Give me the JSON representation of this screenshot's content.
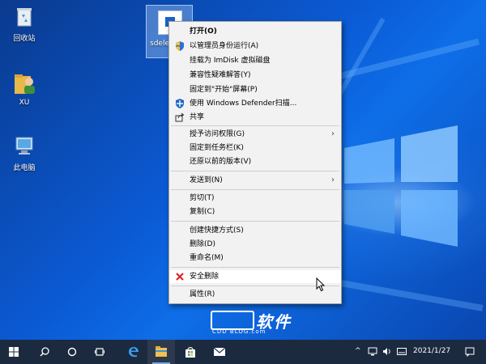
{
  "desktop": {
    "icons": [
      {
        "label": "回收站",
        "icon": "recycle-bin-icon"
      },
      {
        "label": "XU",
        "icon": "user-folder-icon"
      },
      {
        "label": "此电脑",
        "icon": "this-pc-icon"
      }
    ],
    "selected_file": {
      "label": "sdele",
      "icon": "file-icon"
    }
  },
  "context_menu": {
    "items": [
      {
        "label": "打开(O)",
        "bold": true
      },
      {
        "label": "以管理员身份运行(A)",
        "icon": "uac-shield-icon"
      },
      {
        "label": "挂载为 ImDisk 虚拟磁盘"
      },
      {
        "label": "兼容性疑难解答(Y)"
      },
      {
        "label": "固定到\"开始\"屏幕(P)"
      },
      {
        "label": "使用 Windows Defender扫描...",
        "icon": "defender-icon"
      },
      {
        "label": "共享",
        "icon": "share-icon"
      },
      {
        "label": "授予访问权限(G)",
        "submenu": true
      },
      {
        "label": "固定到任务栏(K)"
      },
      {
        "label": "还原以前的版本(V)"
      },
      {
        "label": "发送到(N)",
        "submenu": true
      },
      {
        "label": "剪切(T)"
      },
      {
        "label": "复制(C)"
      },
      {
        "label": "创建快捷方式(S)"
      },
      {
        "label": "删除(D)"
      },
      {
        "label": "重命名(M)"
      },
      {
        "label": "安全删除",
        "icon": "red-x-icon",
        "highlighted": true
      },
      {
        "label": "属性(R)"
      }
    ],
    "submenu_arrow": "›"
  },
  "watermark": {
    "text": "软件",
    "sub": "CDD BLOG.com"
  },
  "taskbar": {
    "items": [
      "start-icon",
      "search-icon",
      "cortana-icon",
      "task-view-icon",
      "edge-icon",
      "file-explorer-icon",
      "store-icon",
      "mail-icon"
    ],
    "clock": "2021/1/27",
    "tray_chevron": "^"
  },
  "colors": {
    "accent": "#0b5bd6",
    "taskbar": "#1c2a3f",
    "menu_bg": "#f2f2f2"
  }
}
